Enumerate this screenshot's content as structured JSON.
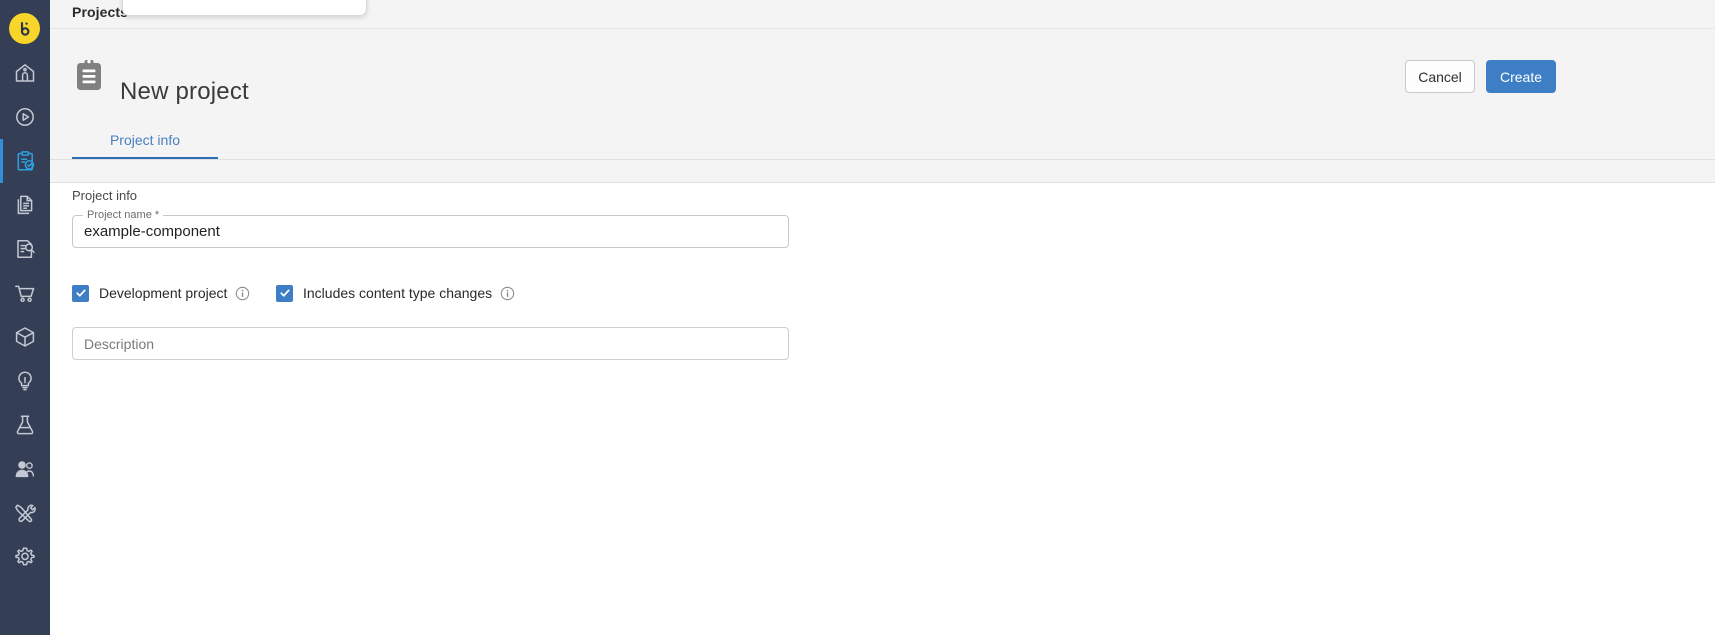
{
  "sidebar": {
    "brand": {
      "name": "bloomreach-logo",
      "label": "b"
    },
    "items": [
      {
        "icon": "home-icon",
        "label": "Home",
        "active": false
      },
      {
        "icon": "play-circle-icon",
        "label": "Experience manager",
        "active": false
      },
      {
        "icon": "clipboard-check-icon",
        "label": "Projects",
        "active": true
      },
      {
        "icon": "documents-icon",
        "label": "Content",
        "active": false
      },
      {
        "icon": "document-search-icon",
        "label": "Content search",
        "active": false
      },
      {
        "icon": "cart-icon",
        "label": "Commerce",
        "active": false
      },
      {
        "icon": "cube-icon",
        "label": "Components",
        "active": false
      },
      {
        "icon": "lightbulb-icon",
        "label": "Insights",
        "active": false
      },
      {
        "icon": "flask-icon",
        "label": "Experiments",
        "active": false
      },
      {
        "icon": "users-icon",
        "label": "Audiences",
        "active": false
      },
      {
        "icon": "tools-icon",
        "label": "Setup",
        "active": false
      },
      {
        "icon": "gear-icon",
        "label": "Settings",
        "active": false
      }
    ]
  },
  "topstrip": {
    "breadcrumb": "Projects",
    "popup_text": ""
  },
  "header": {
    "icon": "clipboard-icon",
    "title": "New project",
    "cancel_label": "Cancel",
    "create_label": "Create"
  },
  "tabs": [
    {
      "label": "Project info",
      "active": true
    }
  ],
  "form": {
    "section_label": "Project info",
    "project_name": {
      "legend": "Project name *",
      "value": "example-component"
    },
    "checkboxes": [
      {
        "label": "Development project",
        "checked": true,
        "info": "info-icon"
      },
      {
        "label": "Includes content type changes",
        "checked": true,
        "info": "info-icon"
      }
    ],
    "description": {
      "placeholder": "Description",
      "value": ""
    }
  },
  "colors": {
    "sidebar_bg": "#343f56",
    "brand_yellow": "#f7d52a",
    "accent_blue": "#3d7ec4",
    "active_icon_blue": "#2f9fe0",
    "tab_underline": "#2f6fb5",
    "header_bg": "#f4f4f4"
  }
}
